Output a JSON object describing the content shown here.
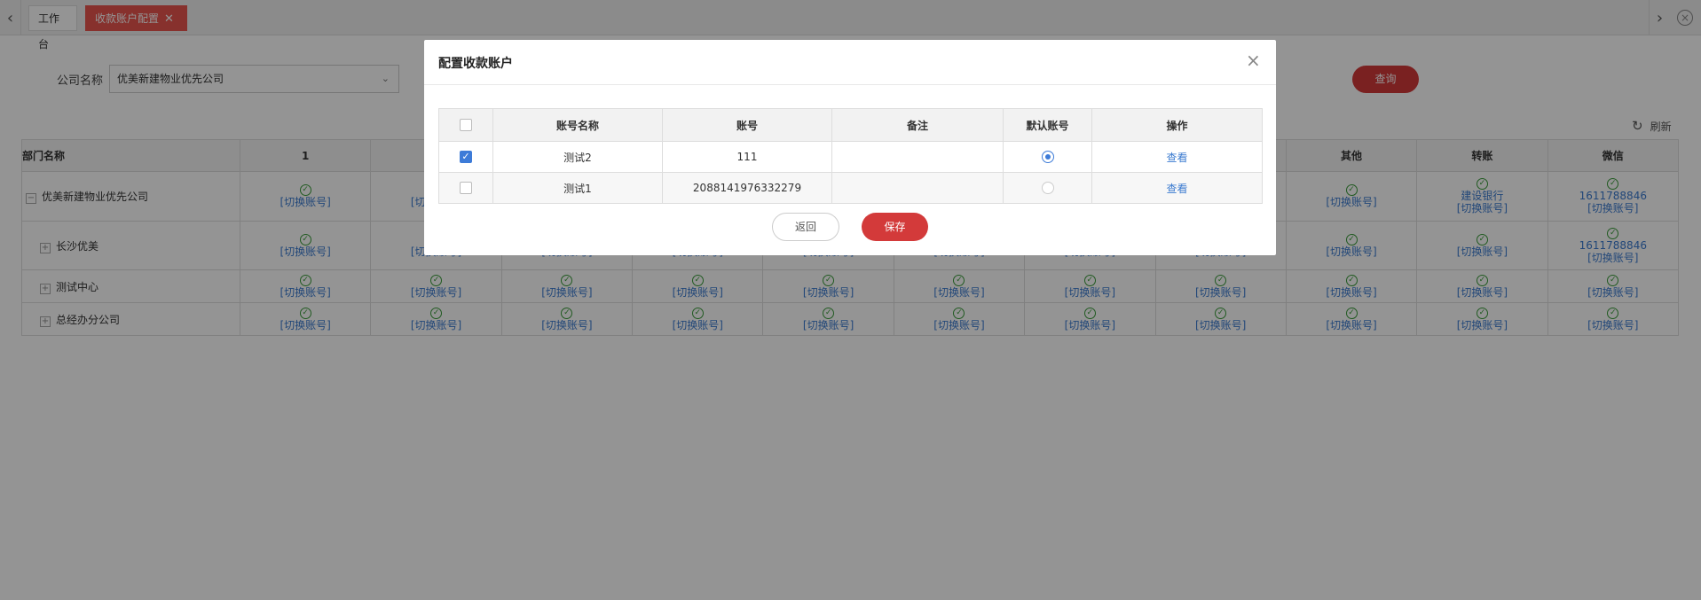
{
  "tabs": [
    {
      "label": "工作台"
    },
    {
      "label": "收款账户配置",
      "close": "✕"
    }
  ],
  "search": {
    "label": "公司名称",
    "company_value": "优美新建物业优先公司",
    "query_label": "查询"
  },
  "refresh_label": "刷新",
  "background_table": {
    "headers": [
      "部门名称",
      "1",
      "",
      "",
      "",
      "",
      "",
      "",
      "",
      "其他",
      "转账",
      "微信"
    ],
    "switch_label": "[切换账号]",
    "rows": [
      {
        "dept": "优美新建物业优先公司",
        "bank": "建设银行",
        "wechat_account": "1611788846"
      },
      {
        "dept": "长沙优美",
        "wechat_account": "1611788846"
      },
      {
        "dept": "测试中心"
      },
      {
        "dept": "总经办分公司"
      }
    ]
  },
  "modal": {
    "title": "配置收款账户",
    "close": "×",
    "columns": [
      "",
      "账号名称",
      "账号",
      "备注",
      "默认账号",
      "操作"
    ],
    "rows": [
      {
        "name": "测试2",
        "account": "111",
        "note": "",
        "checked": true,
        "default": true,
        "action": "查看"
      },
      {
        "name": "测试1",
        "account": "2088141976332279",
        "note": "",
        "checked": false,
        "default": false,
        "action": "查看"
      }
    ],
    "back_label": "返回",
    "save_label": "保存"
  },
  "colors": {
    "accent_red": "#d33a3a",
    "link_blue": "#3b7bd0",
    "ok_green": "#3a9c3a"
  }
}
